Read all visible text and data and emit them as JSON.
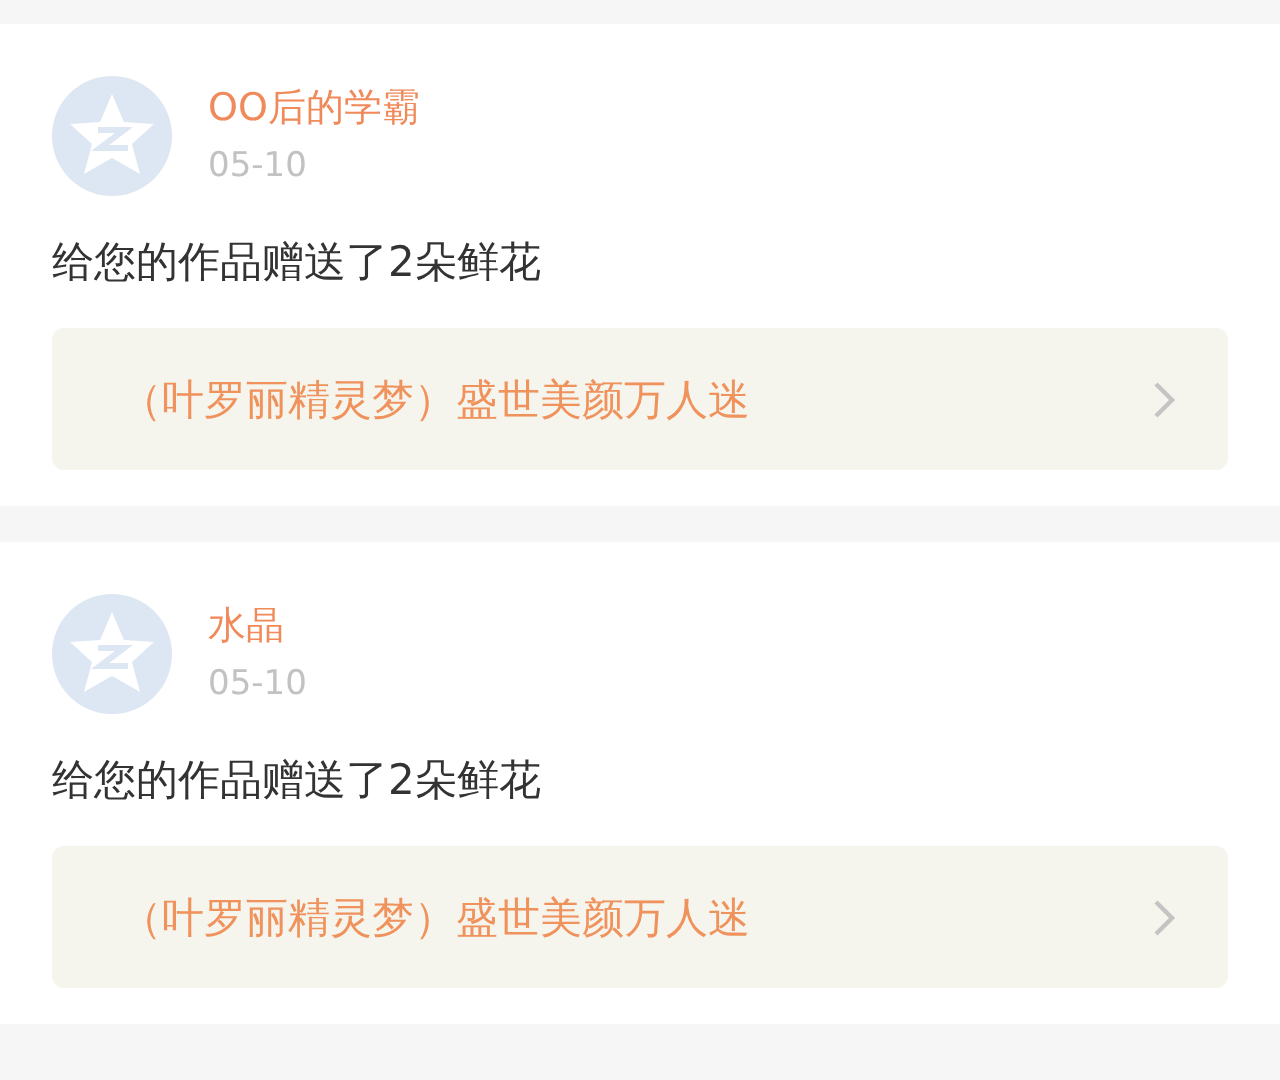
{
  "notifications": [
    {
      "user": "OO后的学霸",
      "date": "05-10",
      "message": "给您的作品赠送了2朵鲜花",
      "work_title": "（叶罗丽精灵梦）盛世美颜万人迷"
    },
    {
      "user": "水晶",
      "date": "05-10",
      "message": "给您的作品赠送了2朵鲜花",
      "work_title": "（叶罗丽精灵梦）盛世美颜万人迷"
    }
  ]
}
